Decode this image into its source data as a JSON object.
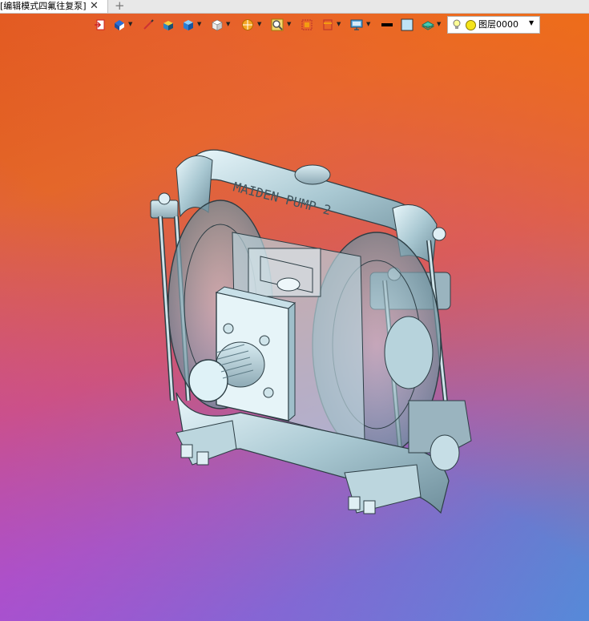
{
  "tab": {
    "title": "[编辑模式四氟往复泵]",
    "close": "✕",
    "add": "+"
  },
  "toolbar": {
    "layer_label": "图层0000",
    "dropdown_arrow": "▼",
    "tools": [
      {
        "icon": "exit-sketch-icon"
      },
      {
        "icon": "view-orient-icon",
        "dropdown": true
      },
      {
        "icon": "pen-icon"
      },
      {
        "icon": "box-yellow-icon"
      },
      {
        "icon": "cube-blue-icon",
        "dropdown": true
      },
      {
        "icon": "cube-white-icon",
        "dropdown": true
      },
      {
        "icon": "render-icon",
        "dropdown": true
      },
      {
        "icon": "zoom-icon",
        "dropdown": true
      },
      {
        "icon": "fit-icon"
      },
      {
        "icon": "section-icon",
        "dropdown": true
      },
      {
        "icon": "monitor-icon",
        "dropdown": true
      },
      {
        "icon": "line-color-icon"
      },
      {
        "icon": "fill-color-icon"
      },
      {
        "icon": "layer-stack-icon",
        "dropdown": true
      }
    ]
  },
  "model": {
    "label_text": "MAIDEN PUMP 2",
    "name": "diaphragm-pump-model"
  }
}
